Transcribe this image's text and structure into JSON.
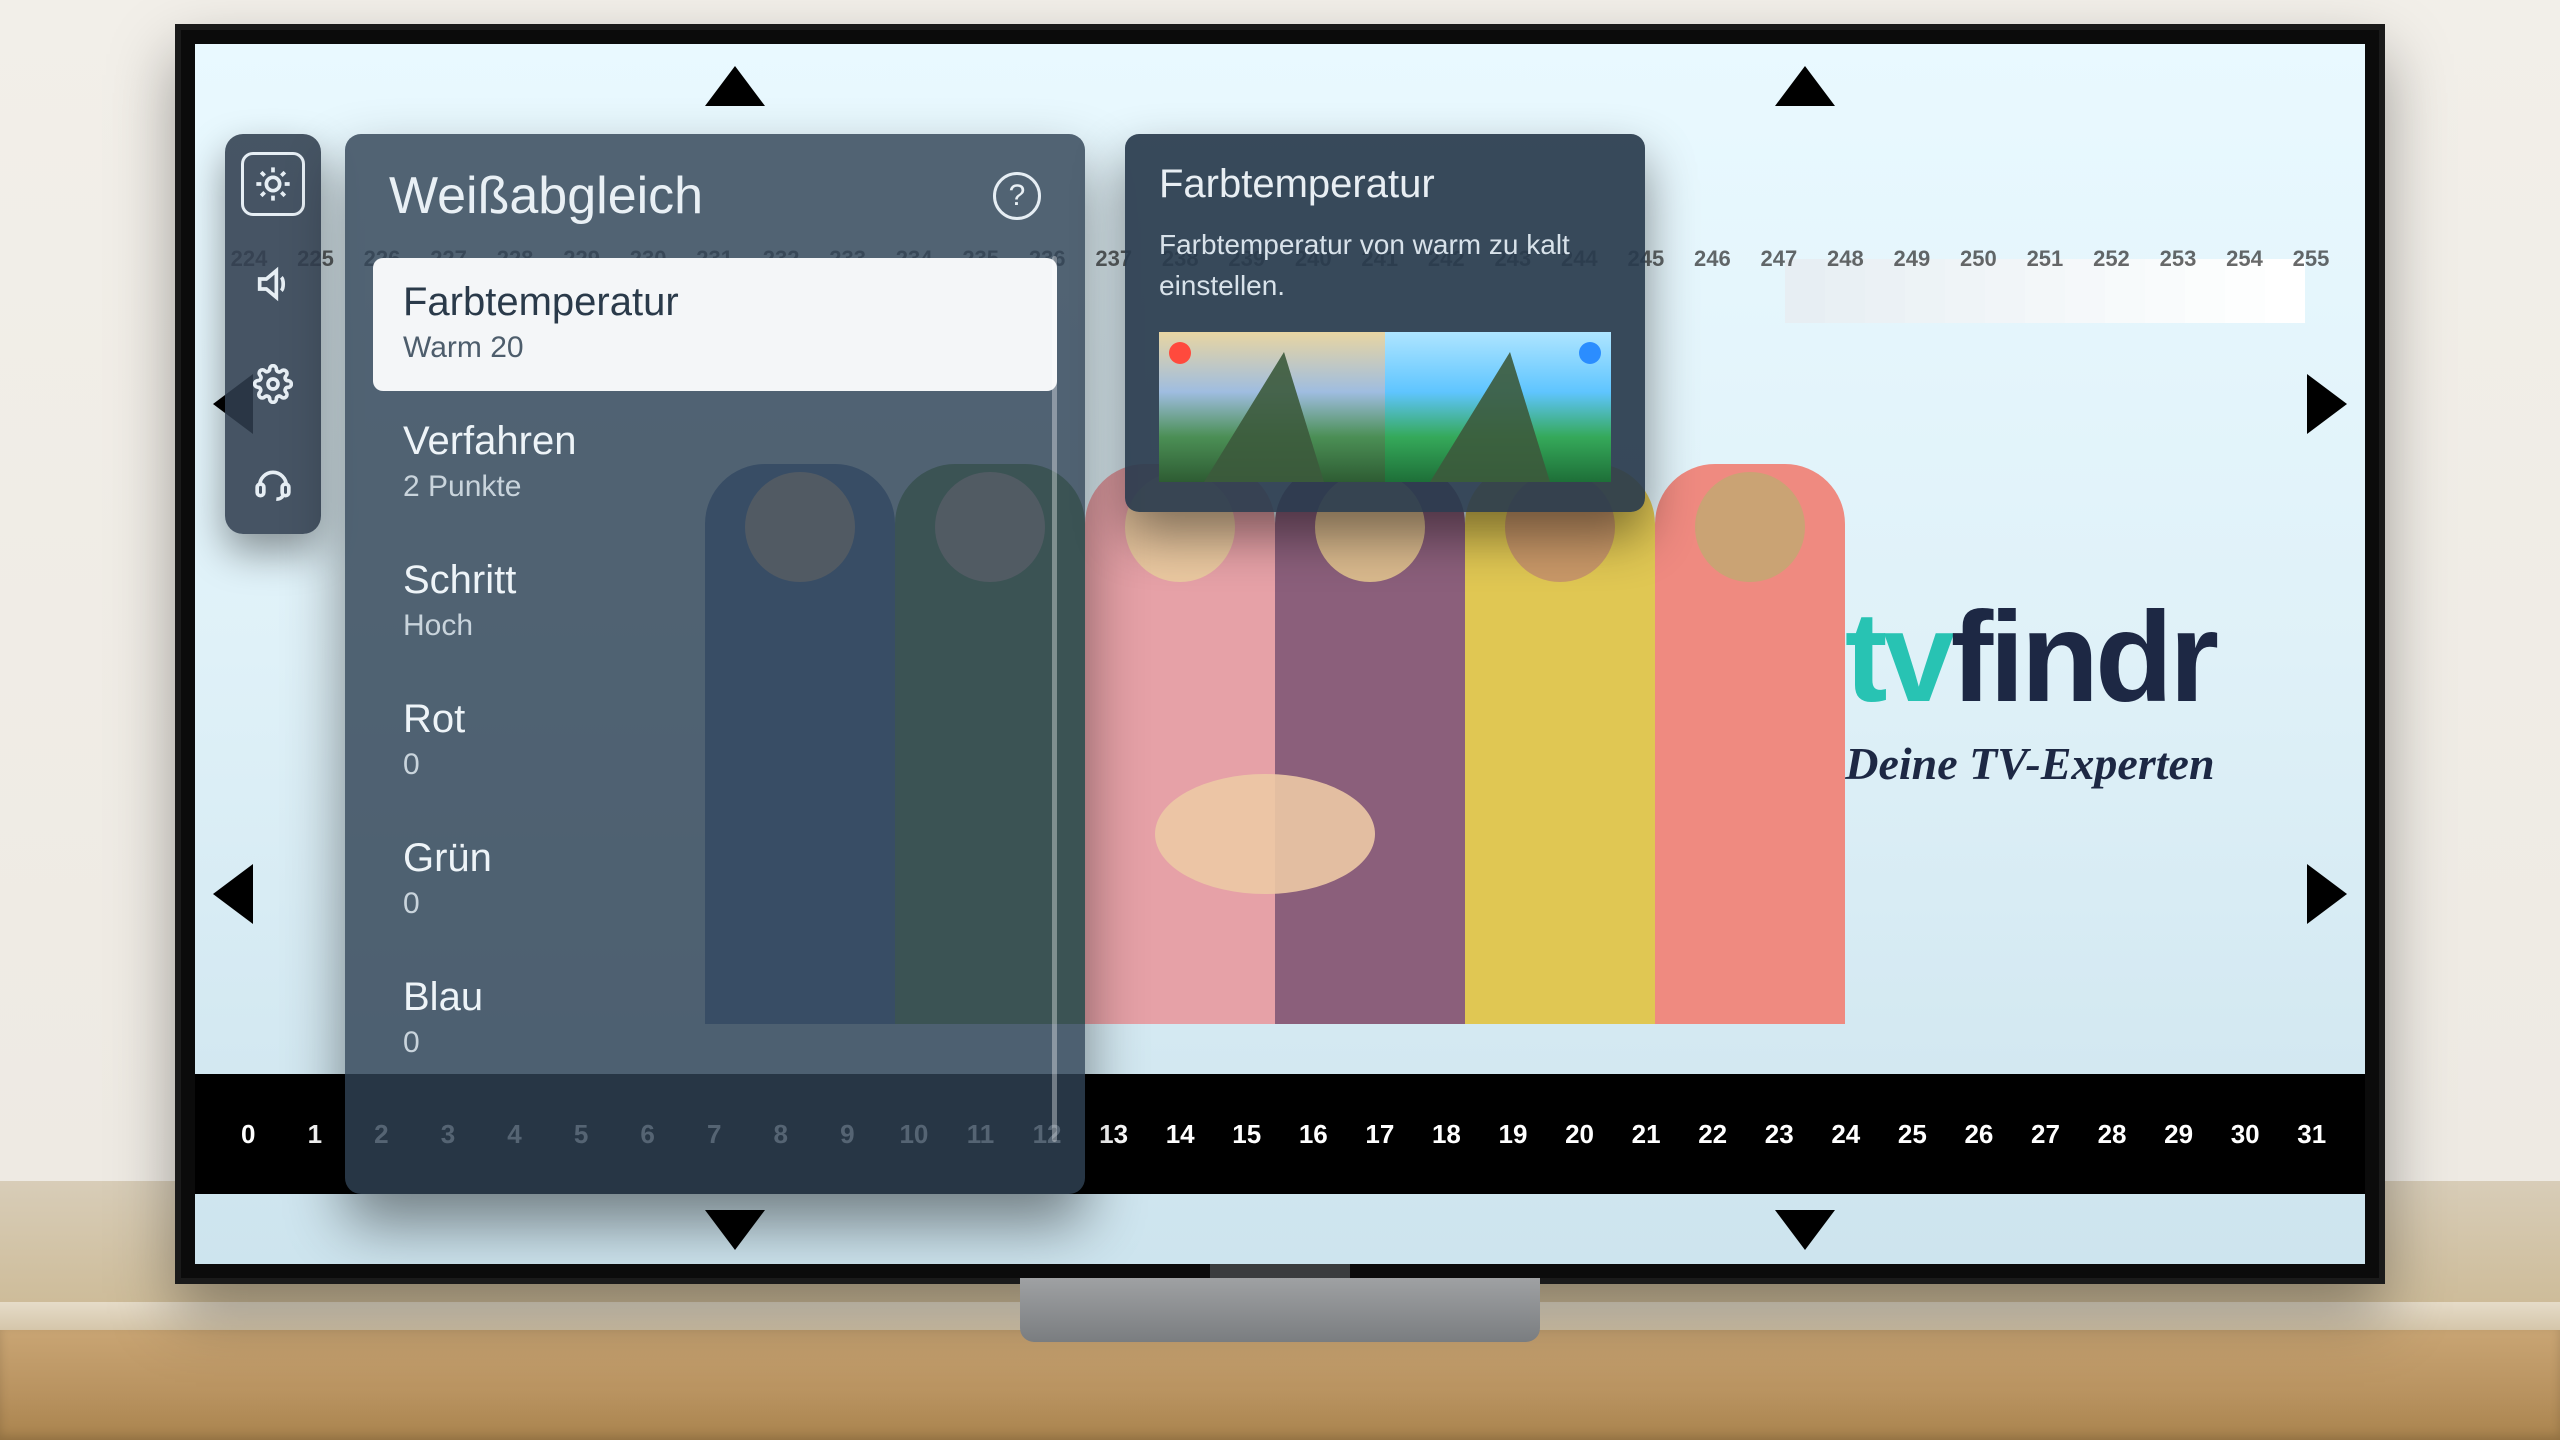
{
  "sidebar": {
    "items": [
      {
        "name": "picture-icon",
        "active": true
      },
      {
        "name": "sound-icon",
        "active": false
      },
      {
        "name": "settings-icon",
        "active": false
      },
      {
        "name": "support-icon",
        "active": false
      }
    ]
  },
  "panel": {
    "title": "Weißabgleich",
    "help": "?",
    "items": [
      {
        "label": "Farbtemperatur",
        "value": "Warm 20",
        "selected": true
      },
      {
        "label": "Verfahren",
        "value": "2 Punkte",
        "selected": false
      },
      {
        "label": "Schritt",
        "value": "Hoch",
        "selected": false
      },
      {
        "label": "Rot",
        "value": "0",
        "selected": false
      },
      {
        "label": "Grün",
        "value": "0",
        "selected": false
      },
      {
        "label": "Blau",
        "value": "0",
        "selected": false
      }
    ]
  },
  "info": {
    "title": "Farbtemperatur",
    "desc": "Farbtemperatur von warm zu kalt einstellen."
  },
  "logo": {
    "tv": "tv",
    "findr": "findr",
    "tag": "Deine TV-Experten"
  },
  "scales": {
    "top": [
      "224",
      "225",
      "226",
      "227",
      "228",
      "229",
      "230",
      "231",
      "232",
      "233",
      "234",
      "235",
      "236",
      "237",
      "238",
      "239",
      "240",
      "241",
      "242",
      "243",
      "244",
      "245",
      "246",
      "247",
      "248",
      "249",
      "250",
      "251",
      "252",
      "253",
      "254",
      "255"
    ],
    "bottom": [
      "0",
      "1",
      "2",
      "3",
      "4",
      "5",
      "6",
      "7",
      "8",
      "9",
      "10",
      "11",
      "12",
      "13",
      "14",
      "15",
      "16",
      "17",
      "18",
      "19",
      "20",
      "21",
      "22",
      "23",
      "24",
      "25",
      "26",
      "27",
      "28",
      "29",
      "30",
      "31"
    ]
  }
}
